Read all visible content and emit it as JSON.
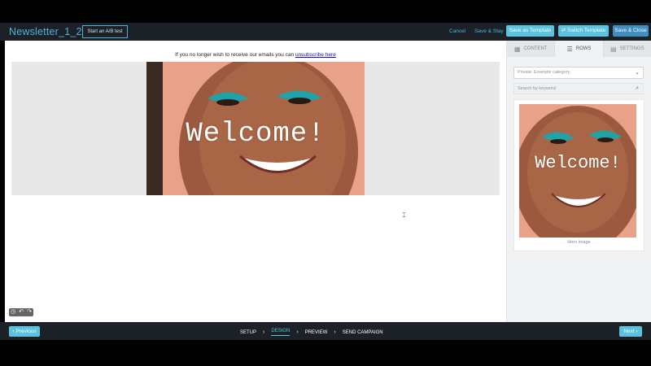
{
  "header": {
    "title": "Newsletter_1_2",
    "ab_test_label": "Start an A/B test",
    "cancel_label": "Cancel",
    "save_stay_label": "Save & Stay",
    "save_template_label": "Save as Template",
    "switch_template_label": "Switch Template",
    "save_close_label": "Save & Close"
  },
  "email": {
    "unsubscribe_prefix": "If you no longer wish to receive our emails you can",
    "unsubscribe_link": "unsubscribe here",
    "hero_text": "Welcome!"
  },
  "sidebar": {
    "tabs": [
      {
        "label": "CONTENT",
        "icon": "grid-icon"
      },
      {
        "label": "ROWS",
        "icon": "rows-icon"
      },
      {
        "label": "SETTINGS",
        "icon": "settings-icon"
      }
    ],
    "category_select": "Private: Example category",
    "search_placeholder": "Search by keyword",
    "card_text": "Welcome!",
    "card_caption": "Hero image"
  },
  "footer": {
    "previous_label": "Previous",
    "next_label": "Next",
    "steps": [
      "SETUP",
      "DESIGN",
      "PREVIEW",
      "SEND CAMPAIGN"
    ],
    "active_step": "DESIGN"
  },
  "colors": {
    "accent": "#5bc3df",
    "brand_blue": "#4fb3d9",
    "dark_bar": "#1c2127"
  }
}
